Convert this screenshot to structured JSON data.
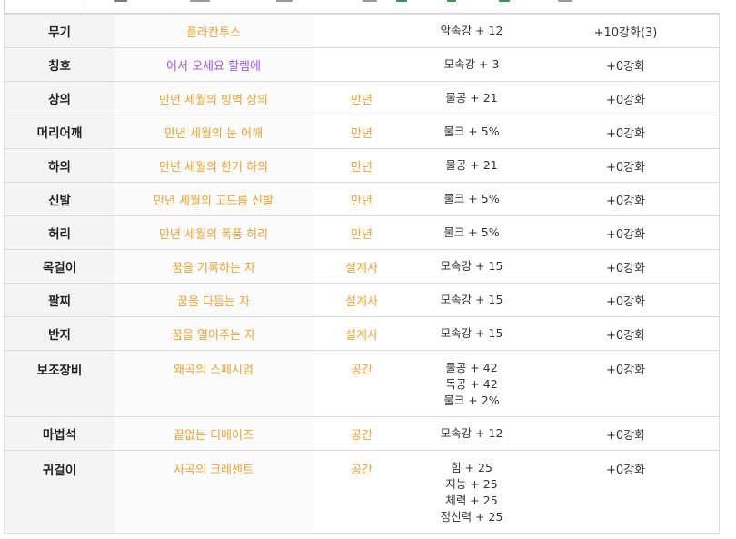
{
  "rows": [
    {
      "slot": "무기",
      "name": "플라칸투스",
      "name_color": "#e3a43a",
      "set": "",
      "options": [
        "암속강 + 12"
      ],
      "enhance": "+10강화(3)"
    },
    {
      "slot": "칭호",
      "name": "어서 오세요 할렘에",
      "name_color": "#9b59d0",
      "set": "",
      "options": [
        "모속강 + 3"
      ],
      "enhance": "+0강화"
    },
    {
      "slot": "상의",
      "name": "만년 세월의 빙벽 상의",
      "name_color": "#e3a43a",
      "set": "만년",
      "options": [
        "물공 + 21"
      ],
      "enhance": "+0강화"
    },
    {
      "slot": "머리어깨",
      "name": "만년 세월의 눈 어깨",
      "name_color": "#e3a43a",
      "set": "만년",
      "options": [
        "물크 + 5%"
      ],
      "enhance": "+0강화"
    },
    {
      "slot": "하의",
      "name": "만년 세월의 한기 하의",
      "name_color": "#e3a43a",
      "set": "만년",
      "options": [
        "물공 + 21"
      ],
      "enhance": "+0강화"
    },
    {
      "slot": "신발",
      "name": "만년 세월의 고드름 신발",
      "name_color": "#e3a43a",
      "set": "만년",
      "options": [
        "물크 + 5%"
      ],
      "enhance": "+0강화"
    },
    {
      "slot": "허리",
      "name": "만년 세월의 폭풍 허리",
      "name_color": "#e3a43a",
      "set": "만년",
      "options": [
        "물크 + 5%"
      ],
      "enhance": "+0강화"
    },
    {
      "slot": "목걸이",
      "name": "꿈을 기록하는 자",
      "name_color": "#e3a43a",
      "set": "설계사",
      "options": [
        "모속강 + 15"
      ],
      "enhance": "+0강화"
    },
    {
      "slot": "팔찌",
      "name": "꿈을 다듬는 자",
      "name_color": "#e3a43a",
      "set": "설계사",
      "options": [
        "모속강 + 15"
      ],
      "enhance": "+0강화"
    },
    {
      "slot": "반지",
      "name": "꿈을 열어주는 자",
      "name_color": "#e3a43a",
      "set": "설계사",
      "options": [
        "모속강 + 15"
      ],
      "enhance": "+0강화"
    },
    {
      "slot": "보조장비",
      "name": "왜곡의 스페시엄",
      "name_color": "#e3a43a",
      "set": "공간",
      "options": [
        "물공 + 42",
        "독공 + 42",
        "물크 + 2%"
      ],
      "enhance": "+0강화"
    },
    {
      "slot": "마법석",
      "name": "끝없는 디메이즈",
      "name_color": "#e3a43a",
      "set": "공간",
      "options": [
        "모속강 + 12"
      ],
      "enhance": "+0강화"
    },
    {
      "slot": "귀걸이",
      "name": "사곡의 크레센트",
      "name_color": "#e3a43a",
      "set": "공간",
      "options": [
        "힘 + 25",
        "지능 + 25",
        "체력 + 25",
        "정신력 + 25"
      ],
      "enhance": "+0강화"
    }
  ]
}
